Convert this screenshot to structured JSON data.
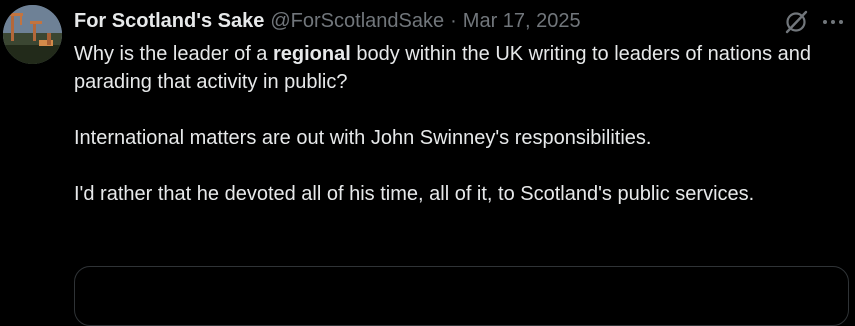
{
  "tweet": {
    "author_name": "For Scotland's Sake",
    "author_handle": "@ForScotlandSake",
    "separator": "·",
    "date": "Mar 17, 2025",
    "paragraph1": {
      "before": "Why is the leader of a ",
      "emphasis": "regional",
      "after": " body within the UK writing to leaders of nations and parading that activity in public?"
    },
    "paragraph2": "International matters are out with John Swinney's responsibilities.",
    "paragraph3": "I'd rather that he devoted all of his time, all of it, to Scotland's public services."
  },
  "icons": {
    "grok": "grok-icon",
    "more": "more-options-icon"
  },
  "colors": {
    "background": "#000000",
    "text_primary": "#e7e9ea",
    "text_secondary": "#71767b",
    "border": "#2f3336"
  }
}
